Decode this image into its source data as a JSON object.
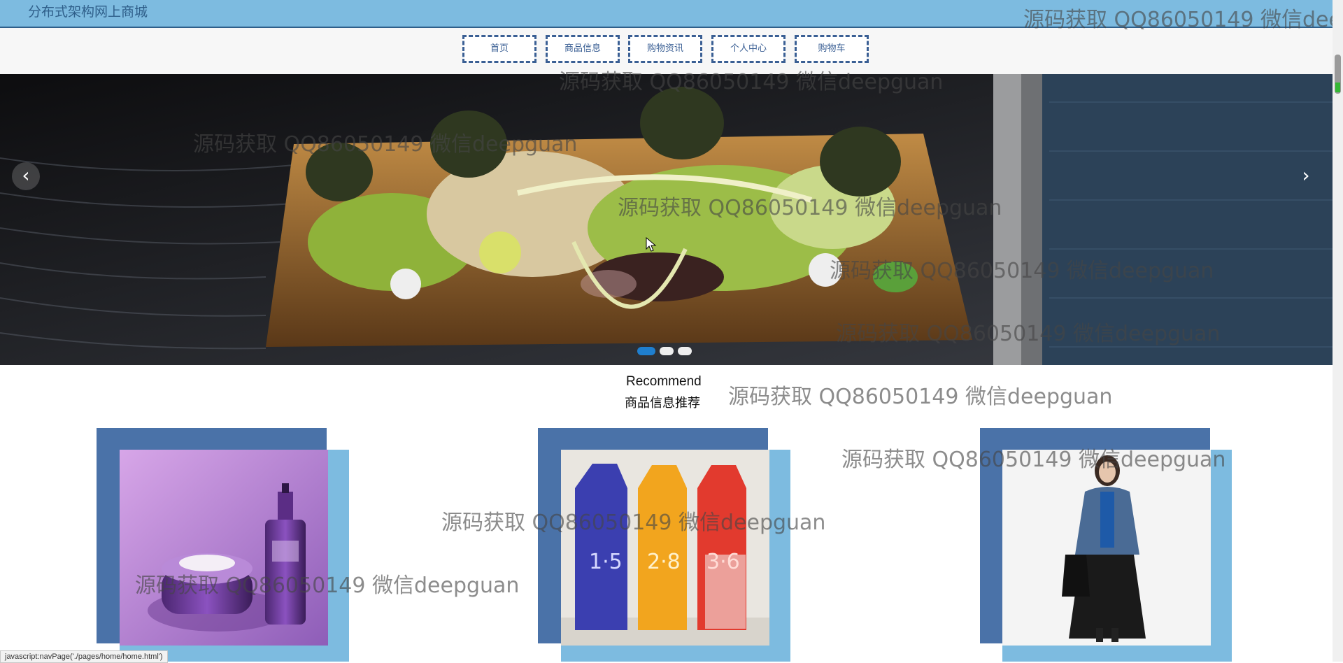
{
  "header": {
    "site_title": "分布式架构网上商城"
  },
  "nav": {
    "items": [
      {
        "label": "首页"
      },
      {
        "label": "商品信息"
      },
      {
        "label": "购物资讯"
      },
      {
        "label": "个人中心"
      },
      {
        "label": "购物车"
      }
    ]
  },
  "carousel": {
    "prev_icon": "chevron-left-icon",
    "next_icon": "chevron-right-icon",
    "slide_count": 3,
    "active_slide": 1
  },
  "recommend": {
    "title_en": "Recommend",
    "title_cn": "商品信息推荐"
  },
  "products": [
    {
      "image": "cosmetics-photo"
    },
    {
      "image": "milk-cartons-photo"
    },
    {
      "image": "fashion-model-photo"
    }
  ],
  "watermark": {
    "text": "源码获取 QQ86050149 微信deepguan",
    "text_truncated": "源码获取 QQ86050149 微信deep"
  },
  "status_bar": {
    "text": "javascript:navPage('./pages/home/home.html')"
  },
  "colors": {
    "header_bg": "#7dbbe0",
    "nav_border": "#3a5f94",
    "card_dark": "#4a72a8",
    "card_light": "#7dbbe0",
    "dot_active": "#1f7fcf"
  }
}
